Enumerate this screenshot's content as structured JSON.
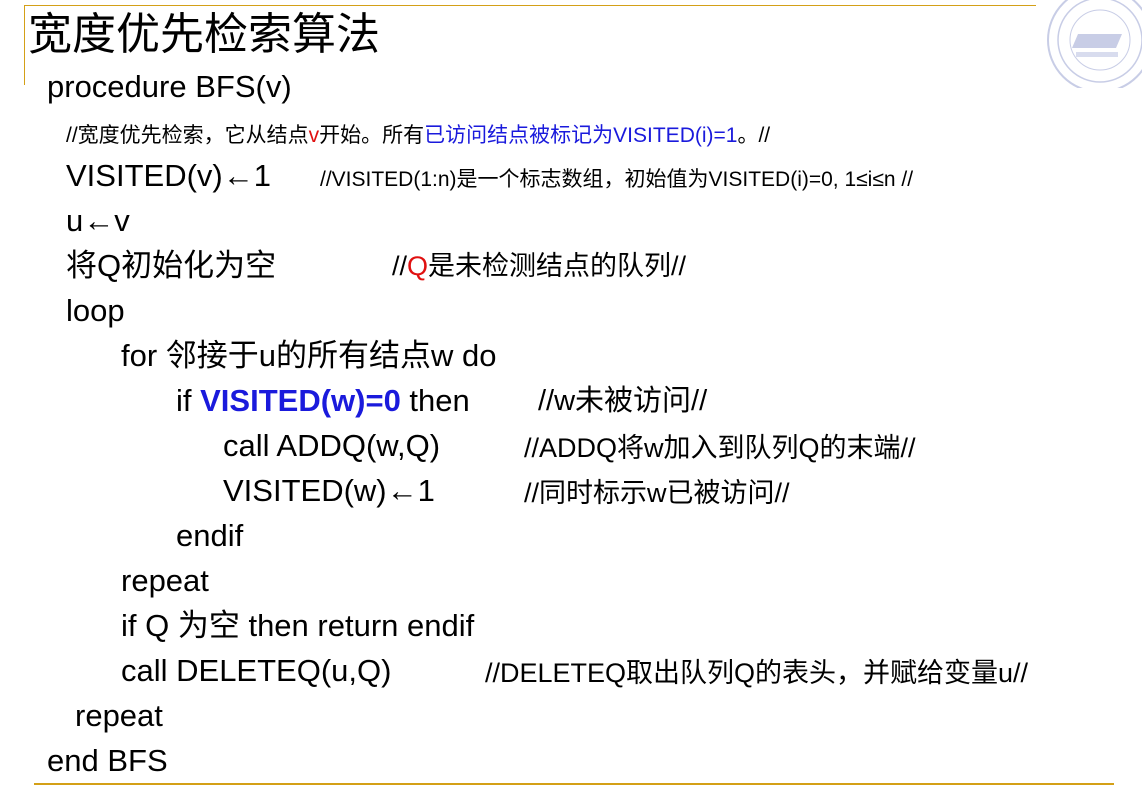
{
  "title": "宽度优先检索算法",
  "lines": {
    "proc": "procedure BFS(v)",
    "desc": {
      "part1": "//宽度优先检索，它从结点",
      "v": "v",
      "part2": "开始。所有",
      "blue": "已访问结点被标记为VISITED(i)=1",
      "part3": "。//"
    },
    "visited_init": {
      "code": "VISITED(v)←1",
      "comment": "//VISITED(1:n)是一个标志数组，初始值为VISITED(i)=0, 1≤i≤n //"
    },
    "u_assign": "u←v",
    "q_init": {
      "code": "将Q初始化为空",
      "comment_pre": "//",
      "comment_q": "Q",
      "comment_post": "是未检测结点的队列//"
    },
    "loop": "loop",
    "for": "for 邻接于u的所有结点w do",
    "if": {
      "kw": "if ",
      "cond": "VISITED(w)=0",
      "then": " then",
      "comment": "//w未被访问//"
    },
    "addq": {
      "code": "call ADDQ(w,Q)",
      "comment": "//ADDQ将w加入到队列Q的末端//"
    },
    "mark": {
      "code": "VISITED(w)←1",
      "comment": "//同时标示w已被访问//"
    },
    "endif": "endif",
    "repeat_inner": "repeat",
    "if_empty": "if Q 为空 then return endif",
    "deleteq": {
      "code": "call DELETEQ(u,Q)",
      "comment": "//DELETEQ取出队列Q的表头，并赋给变量u//"
    },
    "repeat_outer": "repeat",
    "end": "end BFS"
  },
  "colors": {
    "accent_rule": "#d4a017",
    "highlight_blue": "#1a1adc",
    "highlight_red": "#e01010"
  },
  "icons": {
    "logo": "university-seal-icon"
  }
}
